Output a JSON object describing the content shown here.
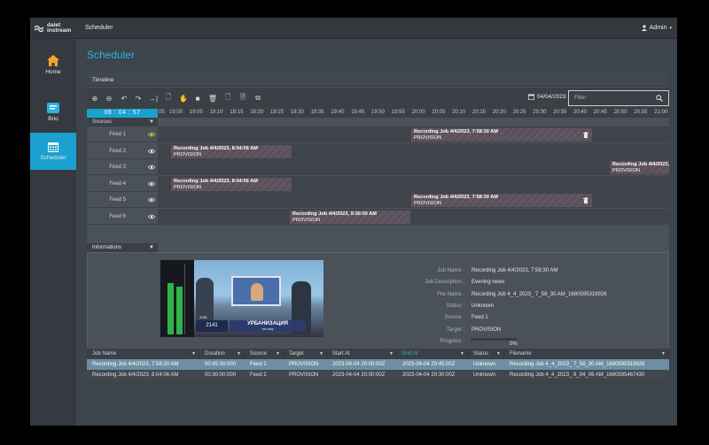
{
  "app": {
    "logo_line1": "dalet",
    "logo_line2": "instream",
    "title": "Scheduler",
    "user": "Admin"
  },
  "sidebar": {
    "items": [
      {
        "label": "Home",
        "icon": "home-icon",
        "active": false
      },
      {
        "label": "Brio",
        "icon": "brio-icon",
        "active": false
      },
      {
        "label": "Scheduler",
        "icon": "calendar-icon",
        "active": true
      }
    ]
  },
  "page": {
    "title": "Scheduler"
  },
  "timeline": {
    "header": "Timeline",
    "date": "04/04/2023",
    "filter_placeholder": "Filter",
    "clock": "08 : 04 : 57",
    "sources_label": "Sources",
    "ticks": [
      "05",
      "19:00",
      "19:05",
      "19:10",
      "19:15",
      "19:20",
      "19:25",
      "19:30",
      "19:35",
      "19:40",
      "19:45",
      "19:50",
      "19:55",
      "20:00",
      "20:05",
      "20:10",
      "20:15",
      "20:20",
      "20:25",
      "20:30",
      "20:35",
      "20:40",
      "20:45",
      "20:50",
      "20:55",
      "21:00"
    ],
    "feeds": [
      {
        "name": "Feed 1",
        "eye_color": "#c7d63a",
        "jobs": [
          {
            "title": "Recording Job 4/4/2023, 7:58:30 AM",
            "target": "PROVISION",
            "trash": true
          }
        ]
      },
      {
        "name": "Feed 2",
        "eye_color": "#e6e8ea",
        "jobs": [
          {
            "title": "Recording Job 4/4/2023, 8:04:06 AM",
            "target": "PROVISION",
            "trash": false
          }
        ]
      },
      {
        "name": "Feed 3",
        "eye_color": "#e6e8ea",
        "jobs": [
          {
            "title": "Recording Job 4/4/2023,",
            "target": "PROVISION",
            "trash": false
          }
        ]
      },
      {
        "name": "Feed 4",
        "eye_color": "#e6e8ea",
        "jobs": [
          {
            "title": "Recording Job 4/4/2023, 8:04:06 AM",
            "target": "PROVISION",
            "trash": false
          }
        ]
      },
      {
        "name": "Feed 5",
        "eye_color": "#e6e8ea",
        "jobs": [
          {
            "title": "Recording Job 4/4/2023, 7:58:30 AM",
            "target": "PROVISION",
            "trash": true
          }
        ]
      },
      {
        "name": "Feed 6",
        "eye_color": "#e6e8ea",
        "jobs": [
          {
            "title": "Recording Job 4/4/2023, 9:30:00 AM",
            "target": "PROVISION",
            "trash": false
          }
        ]
      }
    ]
  },
  "informations": {
    "header": "Informations",
    "preview_caption": "УРБАНИЗАЦИЯ",
    "preview_sub": "тоо шоу",
    "preview_time": "2141",
    "preview_small": "2181",
    "fields": [
      {
        "label": "Job Name :",
        "value": "Recording Job 4/4/2023, 7:58:30 AM"
      },
      {
        "label": "Job Description :",
        "value": "Evening news"
      },
      {
        "label": "File Name :",
        "value": "Recording Job 4_4_2023_ 7_58_30 AM_1680595319926"
      },
      {
        "label": "Status :",
        "value": "Unknown"
      },
      {
        "label": "Source :",
        "value": "Feed 1"
      },
      {
        "label": "Target :",
        "value": "PROVISION"
      },
      {
        "label": "Progress :",
        "value": ""
      }
    ],
    "progress_text": "0%",
    "progress_value": 0
  },
  "table": {
    "columns": [
      "Job Name",
      "Duration",
      "Source",
      "Target",
      "Start At",
      "End At",
      "Status",
      "Filename"
    ],
    "sorted_column": "End At",
    "rows": [
      [
        "Recording Job 4/4/2023, 7:58:30 AM",
        "00:45:00:000",
        "Feed 1",
        "PROVISION",
        "2023-04-04 20:00:00Z",
        "2023-04-04 20:45:00Z",
        "Unknown",
        "Recording Job 4_4_2023_ 7_58_30 AM_1680595319926"
      ],
      [
        "Recording Job 4/4/2023, 8:04:06 AM",
        "00:30:00:000",
        "Feed 2",
        "PROVISION",
        "2023-04-04 20:00:00Z",
        "2023-04-04 20:30:00Z",
        "Unknown",
        "Recording Job 4_4_2023_ 8_04_06 AM_1680595467430"
      ]
    ]
  },
  "colors": {
    "accent": "#1aa1cf",
    "title": "#2ab1de",
    "background": "#3e444b",
    "selected_row": "#6f8ea3"
  }
}
